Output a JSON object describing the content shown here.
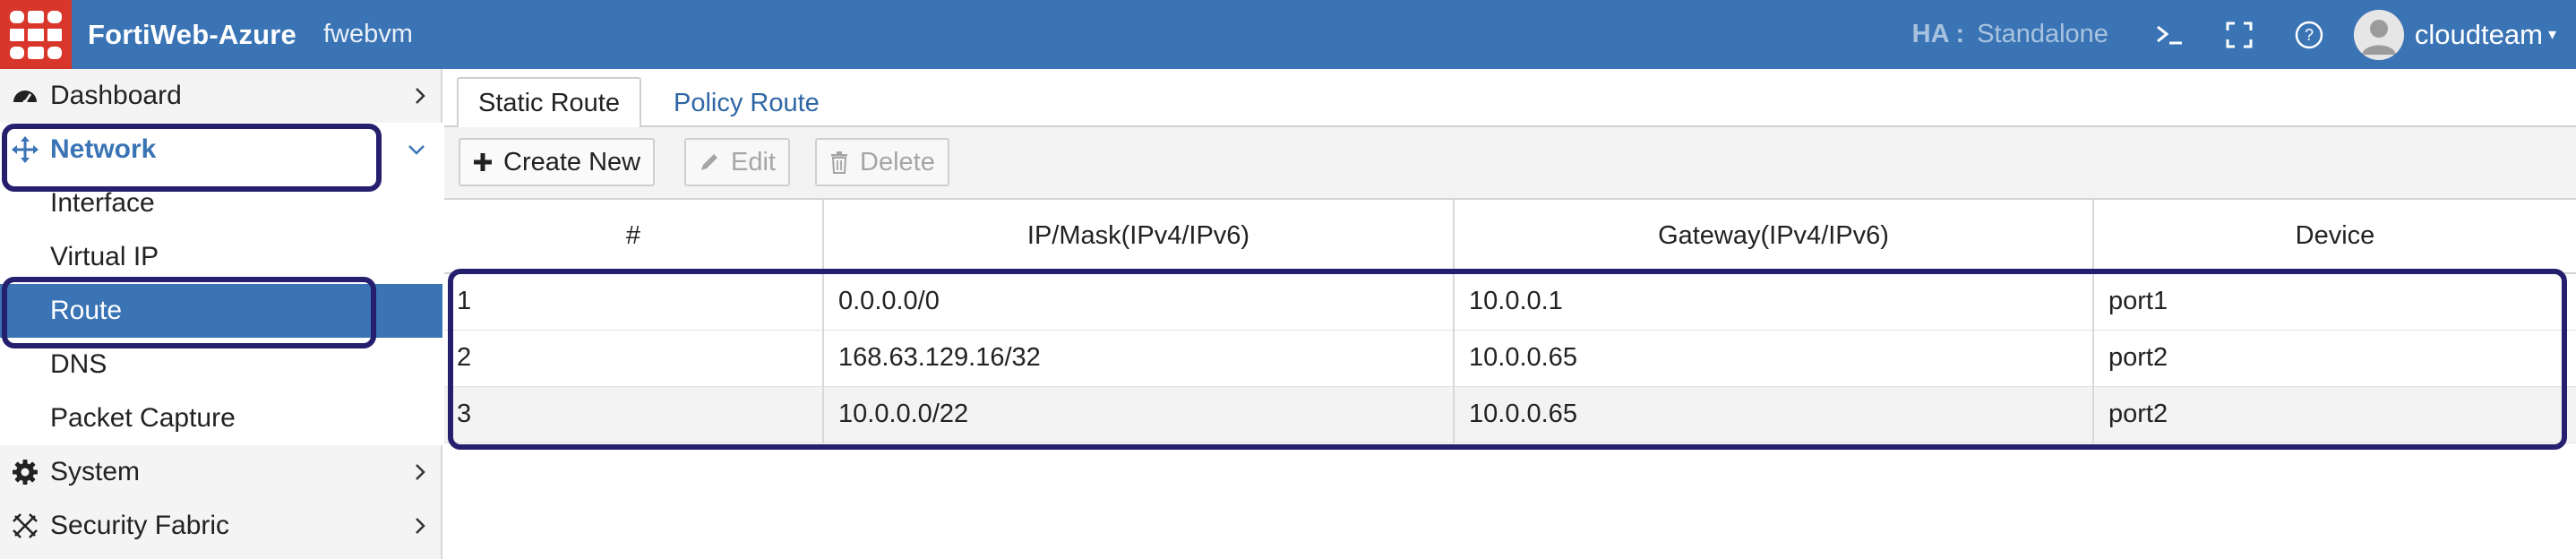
{
  "header": {
    "app_title": "FortiWeb-Azure",
    "host_name": "fwebvm",
    "ha_label": "HA :",
    "ha_value": "Standalone",
    "icons": [
      "terminal-icon",
      "fullscreen-icon",
      "help-icon"
    ],
    "user_name": "cloudteam",
    "brand_color": "#3a74b5",
    "logo_color": "#d9362b"
  },
  "sidebar": {
    "items": [
      {
        "label": "Dashboard",
        "icon": "dashboard-icon",
        "expandable": true
      },
      {
        "label": "Network",
        "icon": "network-move-icon",
        "expanded": true
      },
      {
        "label": "Interface"
      },
      {
        "label": "Virtual IP"
      },
      {
        "label": "Route",
        "active": true
      },
      {
        "label": "DNS"
      },
      {
        "label": "Packet Capture"
      },
      {
        "label": "System",
        "icon": "gear-icon",
        "expandable": true
      },
      {
        "label": "Security Fabric",
        "icon": "security-fabric-icon",
        "expandable": true
      }
    ],
    "active_color": "#3a74b5"
  },
  "tabs": [
    {
      "label": "Static Route",
      "active": true
    },
    {
      "label": "Policy Route",
      "active": false
    }
  ],
  "toolbar": {
    "create_label": "Create New",
    "edit_label": "Edit",
    "delete_label": "Delete"
  },
  "table": {
    "columns": [
      "#",
      "IP/Mask(IPv4/IPv6)",
      "Gateway(IPv4/IPv6)",
      "Device"
    ],
    "rows": [
      {
        "id": "1",
        "ip_mask": "0.0.0.0/0",
        "gateway": "10.0.0.1",
        "device": "port1"
      },
      {
        "id": "2",
        "ip_mask": "168.63.129.16/32",
        "gateway": "10.0.0.65",
        "device": "port2"
      },
      {
        "id": "3",
        "ip_mask": "10.0.0.0/22",
        "gateway": "10.0.0.65",
        "device": "port2"
      }
    ]
  },
  "annotation_color": "#251f6e"
}
